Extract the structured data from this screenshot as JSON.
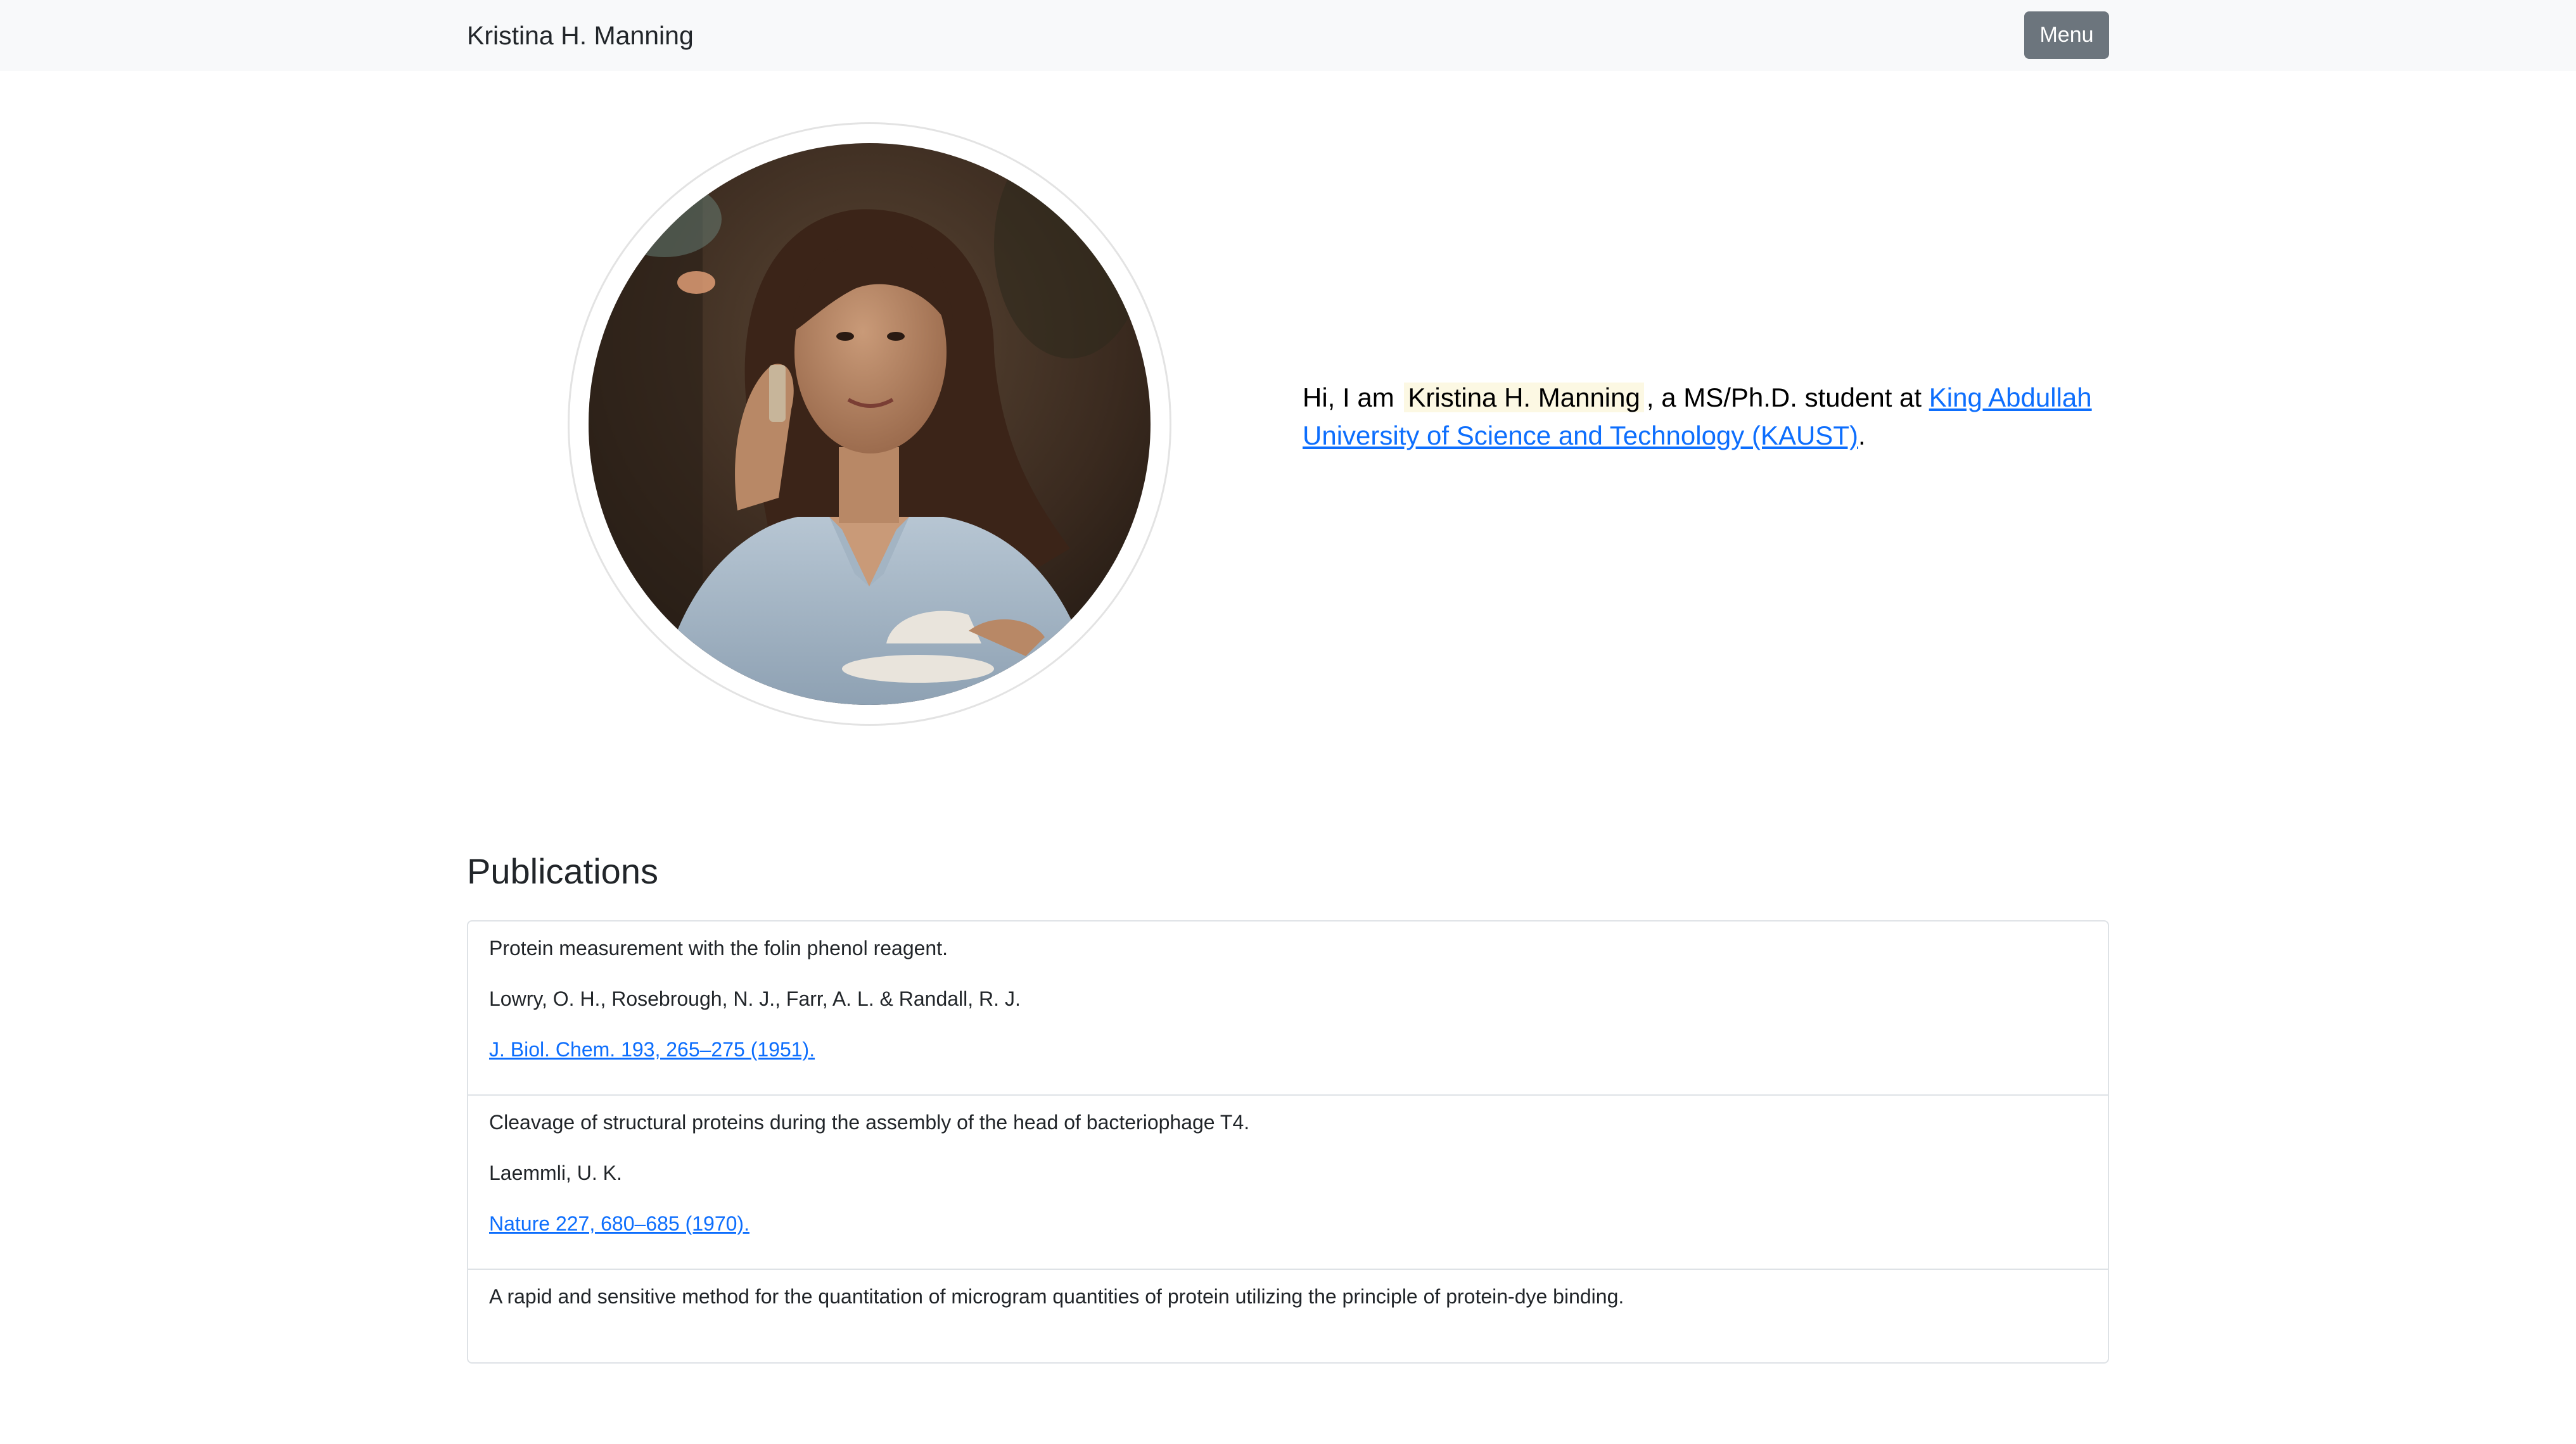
{
  "header": {
    "brand": "Kristina H. Manning",
    "menu_label": "Menu"
  },
  "hero": {
    "avatar_alt": "Portrait of Kristina H. Manning",
    "intro_prefix": "Hi, I am",
    "name_highlight": "Kristina H. Manning",
    "intro_middle": ", a MS/Ph.D. student at",
    "university_link": "King Abdullah University of Science and Technology (KAUST)",
    "intro_suffix": "."
  },
  "publications": {
    "title": "Publications",
    "items": [
      {
        "title": "Protein measurement with the folin phenol reagent.",
        "authors": "Lowry, O. H., Rosebrough, N. J., Farr, A. L. & Randall, R. J.",
        "citation": "J. Biol. Chem. 193, 265–275 (1951)."
      },
      {
        "title": "Cleavage of structural proteins during the assembly of the head of bacteriophage T4.",
        "authors": "Laemmli, U. K.",
        "citation": "Nature 227, 680–685 (1970)."
      },
      {
        "title": "A rapid and sensitive method for the quantitation of microgram quantities of protein utilizing the principle of protein-dye binding."
      }
    ]
  },
  "colors": {
    "navbar_bg": "#f8f9fa",
    "button_bg": "#6c757d",
    "link": "#0d6efd",
    "highlight": "#fcf8e3"
  }
}
